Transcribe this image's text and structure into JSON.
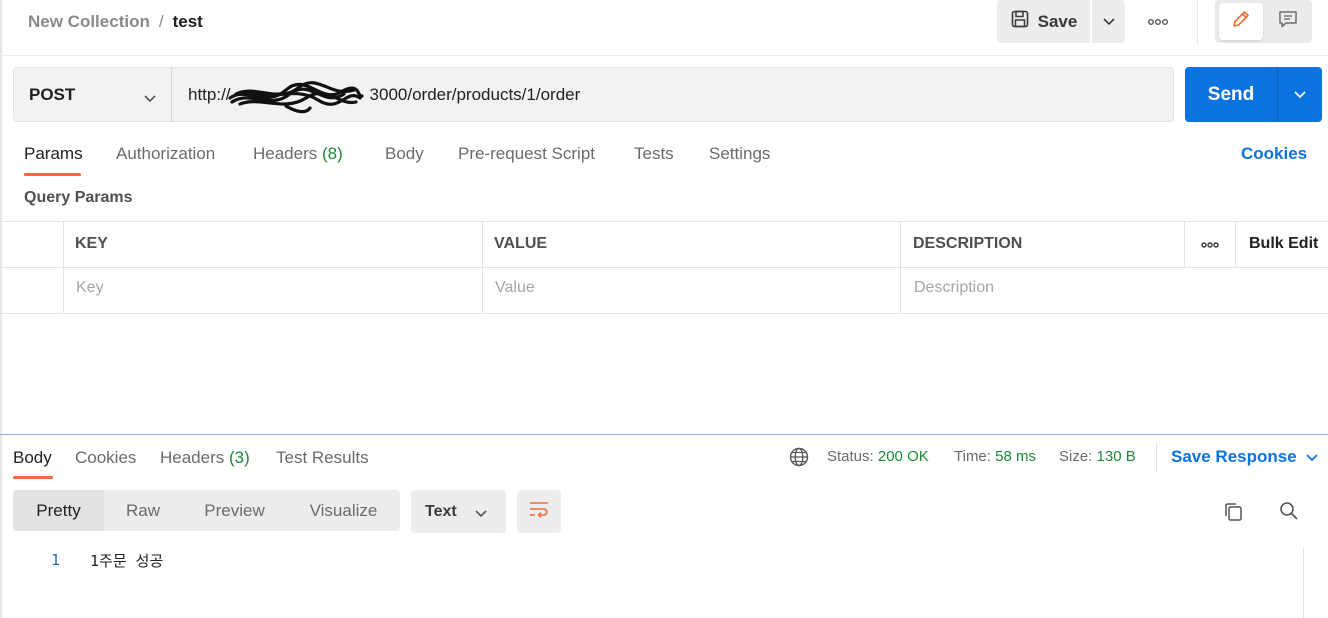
{
  "header": {
    "collection": "New Collection",
    "separator": "/",
    "request_name": "test",
    "save_label": "Save"
  },
  "request": {
    "method": "POST",
    "url_prefix": "http://",
    "url_suffix": "3000/order/products/1/order",
    "send_label": "Send"
  },
  "request_tabs": [
    {
      "label": "Params"
    },
    {
      "label": "Authorization"
    },
    {
      "label": "Headers",
      "count": "(8)"
    },
    {
      "label": "Body"
    },
    {
      "label": "Pre-request Script"
    },
    {
      "label": "Tests"
    },
    {
      "label": "Settings"
    }
  ],
  "cookies_link": "Cookies",
  "query_params": {
    "title": "Query Params",
    "columns": [
      "KEY",
      "VALUE",
      "DESCRIPTION"
    ],
    "bulk_edit": "Bulk Edit",
    "placeholders": [
      "Key",
      "Value",
      "Description"
    ]
  },
  "response": {
    "tabs": [
      {
        "label": "Body"
      },
      {
        "label": "Cookies"
      },
      {
        "label": "Headers",
        "count": "(3)"
      },
      {
        "label": "Test Results"
      }
    ],
    "status_label": "Status:",
    "status_value": "200 OK",
    "time_label": "Time:",
    "time_value": "58 ms",
    "size_label": "Size:",
    "size_value": "130 B",
    "save_response": "Save Response",
    "view_modes": [
      "Pretty",
      "Raw",
      "Preview",
      "Visualize"
    ],
    "format": "Text",
    "lines": [
      {
        "number": "1",
        "text": "1주문 성공"
      }
    ]
  },
  "colors": {
    "accent": "#f26b3a",
    "send": "#0c73e0",
    "link": "#0c73e0",
    "success": "#1d8a3a"
  },
  "icons": [
    "save-icon",
    "chevron-down-icon",
    "more-horizontal-icon",
    "pencil-icon",
    "comment-icon",
    "globe-icon",
    "wrap-lines-icon",
    "copy-icon",
    "search-icon"
  ]
}
